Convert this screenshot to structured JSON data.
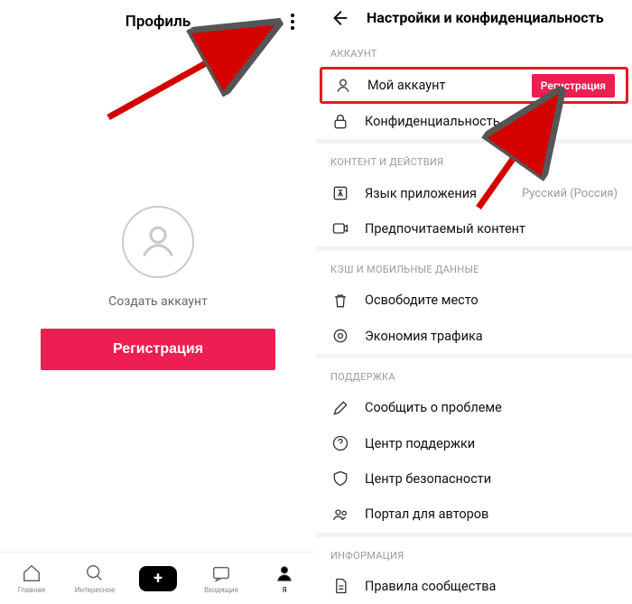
{
  "left": {
    "title": "Профиль",
    "create_label": "Создать аккаунт",
    "register_btn": "Регистрация",
    "nav": {
      "home": "Главная",
      "discover": "Интересное",
      "inbox": "Входящие",
      "me": "Я"
    }
  },
  "right": {
    "title": "Настройки и конфиденциальность",
    "sections": {
      "account_header": "АККАУНТ",
      "my_account": "Мой аккаунт",
      "my_account_badge": "Регистрация",
      "privacy": "Конфиденциальность",
      "content_header": "КОНТЕНТ И ДЕЙСТВИЯ",
      "app_lang": "Язык приложения",
      "app_lang_value": "Русский (Россия)",
      "pref_content": "Предпочитаемый контент",
      "cache_header": "КЭШ И МОБИЛЬНЫЕ ДАННЫЕ",
      "free_space": "Освободите место",
      "data_saver": "Экономия трафика",
      "support_header": "ПОДДЕРЖКА",
      "report": "Сообщить о проблеме",
      "help_center": "Центр поддержки",
      "safety_center": "Центр безопасности",
      "creator_portal": "Портал для авторов",
      "info_header": "ИНФОРМАЦИЯ",
      "community_rules": "Правила сообщества"
    }
  },
  "colors": {
    "accent": "#ee1d52",
    "highlight_border": "#e31b23"
  }
}
